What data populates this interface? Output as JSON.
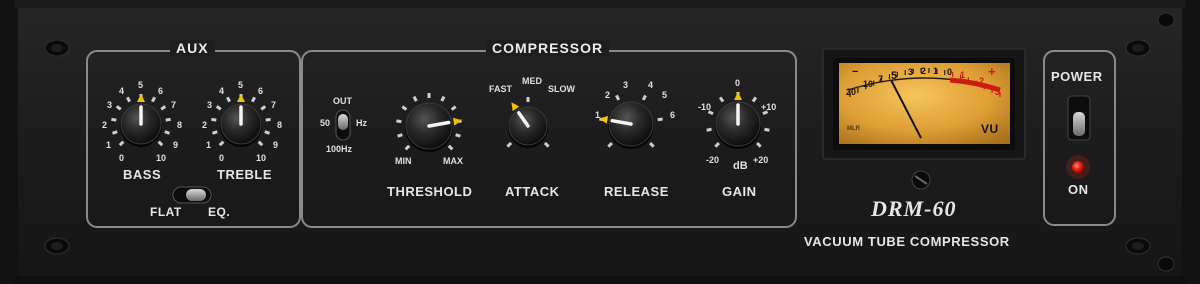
{
  "model": "DRM-60",
  "subtitle": "VACUUM TUBE COMPRESSOR",
  "aux": {
    "title": "AUX",
    "bass": {
      "label": "BASS",
      "min": "0",
      "max": "10",
      "scale": [
        "1",
        "2",
        "3",
        "4",
        "5",
        "6",
        "7",
        "8",
        "9"
      ],
      "value": 5
    },
    "treble": {
      "label": "TREBLE",
      "min": "0",
      "max": "10",
      "scale": [
        "1",
        "2",
        "3",
        "4",
        "5",
        "6",
        "7",
        "8",
        "9"
      ],
      "value": 5
    },
    "eq_switch": {
      "left": "FLAT",
      "right": "EQ.",
      "state": "EQ."
    }
  },
  "compressor": {
    "title": "COMPRESSOR",
    "hpf": {
      "top": "OUT",
      "mid": "50",
      "unit": "Hz",
      "bottom": "100Hz",
      "state": "50"
    },
    "threshold": {
      "label": "THRESHOLD",
      "min": "MIN",
      "max": "MAX",
      "value": 0.82
    },
    "attack": {
      "label": "ATTACK",
      "positions": [
        "FAST",
        "MED",
        "SLOW"
      ],
      "value": "FAST"
    },
    "release": {
      "label": "RELEASE",
      "scale": [
        "1",
        "2",
        "3",
        "4",
        "5",
        "6"
      ],
      "value": "1"
    },
    "gain": {
      "label": "GAIN",
      "scale": [
        "-10",
        "0",
        "+10",
        "-20",
        "dB",
        "+20"
      ],
      "value": "0"
    }
  },
  "vu_meter": {
    "label": "VU",
    "scale": [
      "20",
      "10",
      "7",
      "5",
      "3",
      "2",
      "1",
      "0",
      "1",
      "2",
      "3"
    ],
    "plus": "+",
    "minus": "−",
    "tiny": "MLR",
    "needle_value": "-2"
  },
  "power": {
    "label": "POWER",
    "status": "ON",
    "led_color": "#ff2a1a"
  },
  "colors": {
    "accent": "#f2c200",
    "panel": "#1e1e1e",
    "meter_face": "#e2a53a",
    "red_zone": "#cc1a14"
  }
}
